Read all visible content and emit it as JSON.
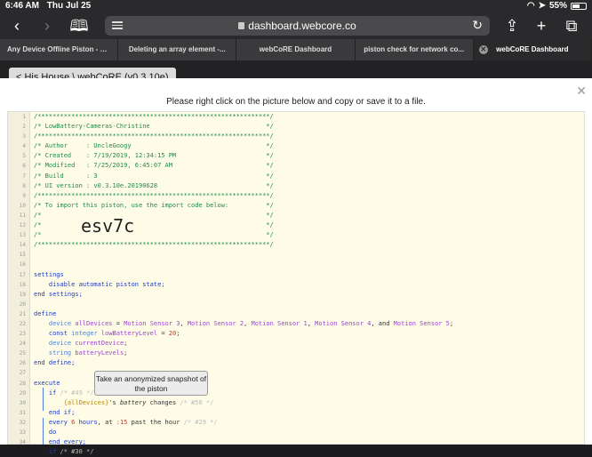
{
  "status": {
    "time": "6:46 AM",
    "date": "Thu Jul 25",
    "battery": "55%",
    "battery_level": 0.55
  },
  "browser": {
    "url": "dashboard.webcore.co",
    "tabs": [
      {
        "label": "Any Device Offline Piston - E..."
      },
      {
        "label": "Deleting an array element -..."
      },
      {
        "label": "webCoRE Dashboard"
      },
      {
        "label": "piston check for network co..."
      },
      {
        "label": "webCoRE Dashboard"
      }
    ]
  },
  "page": {
    "breadcrumb": "< His House \\ webCoRE (v0.3.10e)",
    "hint": "Please right click on the picture below and copy or save it to a file.",
    "import_code": "esv7c",
    "tooltip": "Take an anonymized snapshot of the piston"
  },
  "code": {
    "line_numbers": [
      "1",
      "2",
      "3",
      "4",
      "5",
      "6",
      "7",
      "8",
      "9",
      "10",
      "11",
      "12",
      "13",
      "14",
      "15",
      "16",
      "17",
      "18",
      "19",
      "20",
      "21",
      "22",
      "23",
      "24",
      "25",
      "26",
      "27",
      "28",
      "29",
      "30",
      "31",
      "32",
      "33",
      "34"
    ]
  }
}
